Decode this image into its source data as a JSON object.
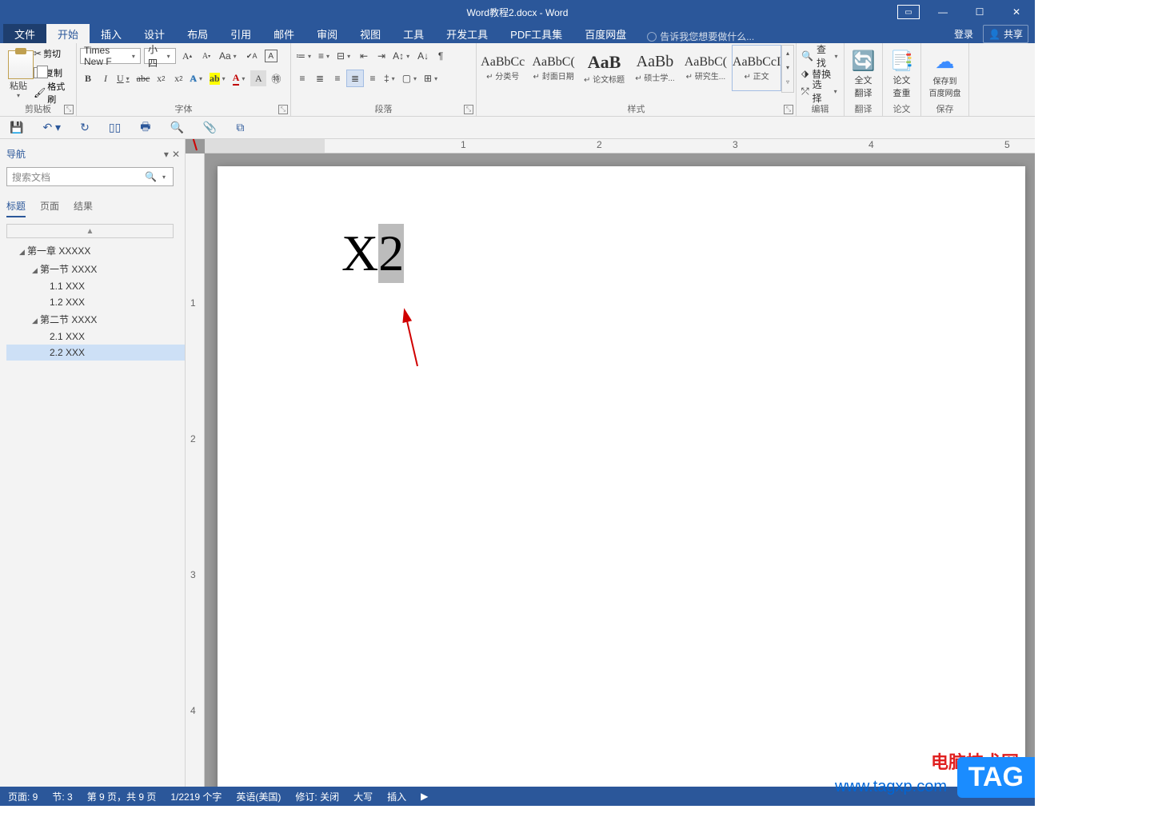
{
  "titlebar": {
    "title": "Word教程2.docx - Word"
  },
  "tabs": {
    "file": "文件",
    "home": "开始",
    "insert": "插入",
    "design": "设计",
    "layout": "布局",
    "ref": "引用",
    "mail": "邮件",
    "review": "审阅",
    "view": "视图",
    "tools": "工具",
    "dev": "开发工具",
    "pdf": "PDF工具集",
    "baidu": "百度网盘",
    "tellme": "告诉我您想要做什么...",
    "login": "登录",
    "share": "共享"
  },
  "clipboard": {
    "paste": "粘贴",
    "cut": "剪切",
    "copy": "复制",
    "painter": "格式刷",
    "title": "剪贴板"
  },
  "font": {
    "name": "Times New F",
    "size": "小四",
    "title": "字体"
  },
  "para": {
    "title": "段落"
  },
  "styles": {
    "title": "样式",
    "items": [
      {
        "prev": "AaBbCc",
        "name": "↵ 分类号"
      },
      {
        "prev": "AaBbC(",
        "name": "↵ 封面日期"
      },
      {
        "prev": "AaB",
        "name": "↵ 论文标题"
      },
      {
        "prev": "AaBb",
        "name": "↵ 硕士学..."
      },
      {
        "prev": "AaBbC(",
        "name": "↵ 研究生..."
      },
      {
        "prev": "AaBbCcI",
        "name": "↵ 正文"
      }
    ]
  },
  "edit": {
    "find": "查找",
    "replace": "替换",
    "select": "选择",
    "title": "编辑"
  },
  "trans": {
    "label": "全文\n翻译",
    "title": "翻译"
  },
  "check": {
    "label": "论文\n查重",
    "title": "论文"
  },
  "save": {
    "label": "保存到\n百度网盘",
    "title": "保存"
  },
  "nav": {
    "title": "导航",
    "search": "搜索文档",
    "tabs": {
      "headings": "标题",
      "pages": "页面",
      "results": "结果"
    },
    "tree": [
      {
        "l": 1,
        "exp": true,
        "t": "第一章 XXXXX"
      },
      {
        "l": 2,
        "exp": true,
        "t": "第一节 XXXX"
      },
      {
        "l": 3,
        "t": "1.1 XXX"
      },
      {
        "l": 3,
        "t": "1.2 XXX"
      },
      {
        "l": 2,
        "exp": true,
        "t": "第二节 XXXX"
      },
      {
        "l": 3,
        "t": "2.1 XXX"
      },
      {
        "l": 3,
        "t": "2.2 XXX",
        "sel": true
      }
    ]
  },
  "doc": {
    "text": "X",
    "seltext": "2"
  },
  "ruler": {
    "marks": [
      "1",
      "2",
      "3",
      "4",
      "5"
    ],
    "vmarks": [
      "1",
      "2",
      "3",
      "4"
    ]
  },
  "status": {
    "page": "页面: 9",
    "sec": "节: 3",
    "pageof": "第 9 页，共 9 页",
    "words": "1/2219 个字",
    "lang": "英语(美国)",
    "track": "修订: 关闭",
    "caps": "大写",
    "ins": "插入"
  },
  "watermark": {
    "site": "电脑技术网",
    "url": "www.tagxp.com",
    "tag": "TAG"
  }
}
